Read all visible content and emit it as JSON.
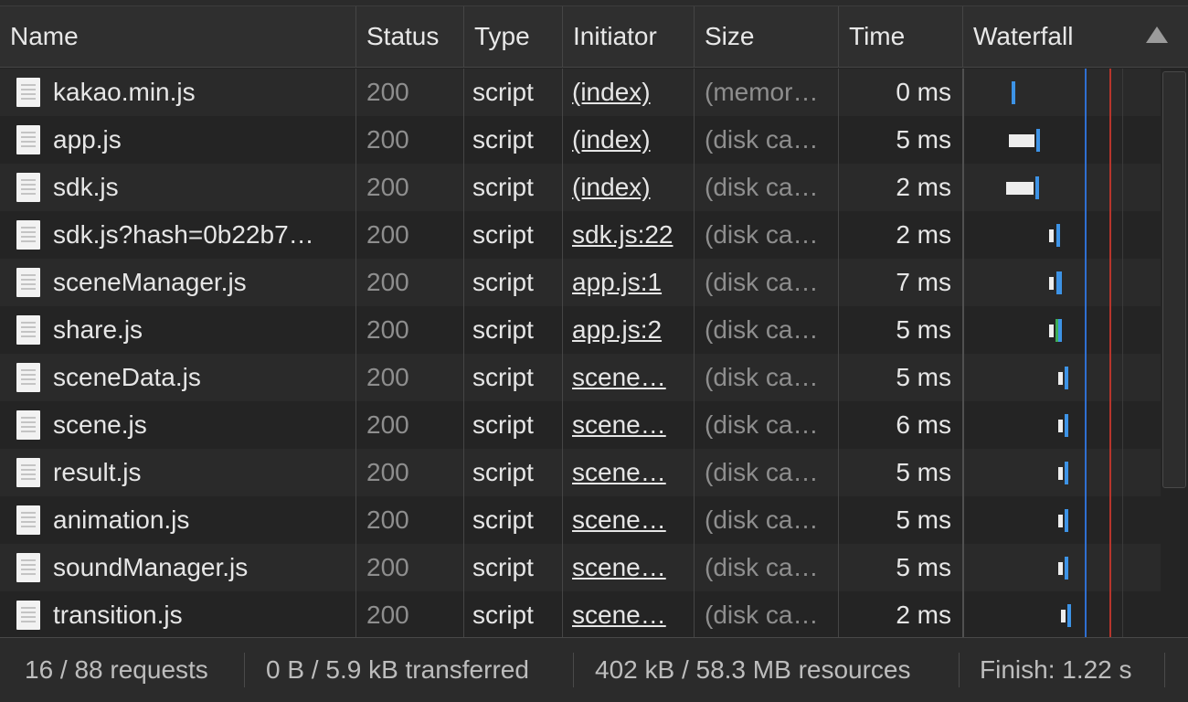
{
  "columns": {
    "name": "Name",
    "status": "Status",
    "type": "Type",
    "initiator": "Initiator",
    "size": "Size",
    "time": "Time",
    "waterfall": "Waterfall"
  },
  "rows": [
    {
      "name": "kakao.min.js",
      "status": "200",
      "type": "script",
      "initiator": "(index)",
      "size": "(memor…",
      "time": "0 ms"
    },
    {
      "name": "app.js",
      "status": "200",
      "type": "script",
      "initiator": "(index)",
      "size": "(disk ca…",
      "time": "5 ms"
    },
    {
      "name": "sdk.js",
      "status": "200",
      "type": "script",
      "initiator": "(index)",
      "size": "(disk ca…",
      "time": "2 ms"
    },
    {
      "name": "sdk.js?hash=0b22b7…",
      "status": "200",
      "type": "script",
      "initiator": "sdk.js:22",
      "size": "(disk ca…",
      "time": "2 ms"
    },
    {
      "name": "sceneManager.js",
      "status": "200",
      "type": "script",
      "initiator": "app.js:1",
      "size": "(disk ca…",
      "time": "7 ms"
    },
    {
      "name": "share.js",
      "status": "200",
      "type": "script",
      "initiator": "app.js:2",
      "size": "(disk ca…",
      "time": "5 ms"
    },
    {
      "name": "sceneData.js",
      "status": "200",
      "type": "script",
      "initiator": "scene…",
      "size": "(disk ca…",
      "time": "5 ms"
    },
    {
      "name": "scene.js",
      "status": "200",
      "type": "script",
      "initiator": "scene…",
      "size": "(disk ca…",
      "time": "6 ms"
    },
    {
      "name": "result.js",
      "status": "200",
      "type": "script",
      "initiator": "scene…",
      "size": "(disk ca…",
      "time": "5 ms"
    },
    {
      "name": "animation.js",
      "status": "200",
      "type": "script",
      "initiator": "scene…",
      "size": "(disk ca…",
      "time": "5 ms"
    },
    {
      "name": "soundManager.js",
      "status": "200",
      "type": "script",
      "initiator": "scene…",
      "size": "(disk ca…",
      "time": "5 ms"
    },
    {
      "name": "transition.js",
      "status": "200",
      "type": "script",
      "initiator": "scene…",
      "size": "(disk ca…",
      "time": "2 ms"
    }
  ],
  "footer": {
    "requests": "16 / 88 requests",
    "transferred": "0 B / 5.9 kB transferred",
    "resources": "402 kB / 58.3 MB resources",
    "finish": "Finish: 1.22 s"
  },
  "icons": {
    "file": "file-icon",
    "sort": "sort-ascending-icon"
  },
  "colors": {
    "background": "#242424",
    "row_alt": "#2a2a2a",
    "receive_bar": "#3d93e6",
    "dom_content_loaded_line": "#2f6fd1",
    "load_line": "#c0392b"
  }
}
